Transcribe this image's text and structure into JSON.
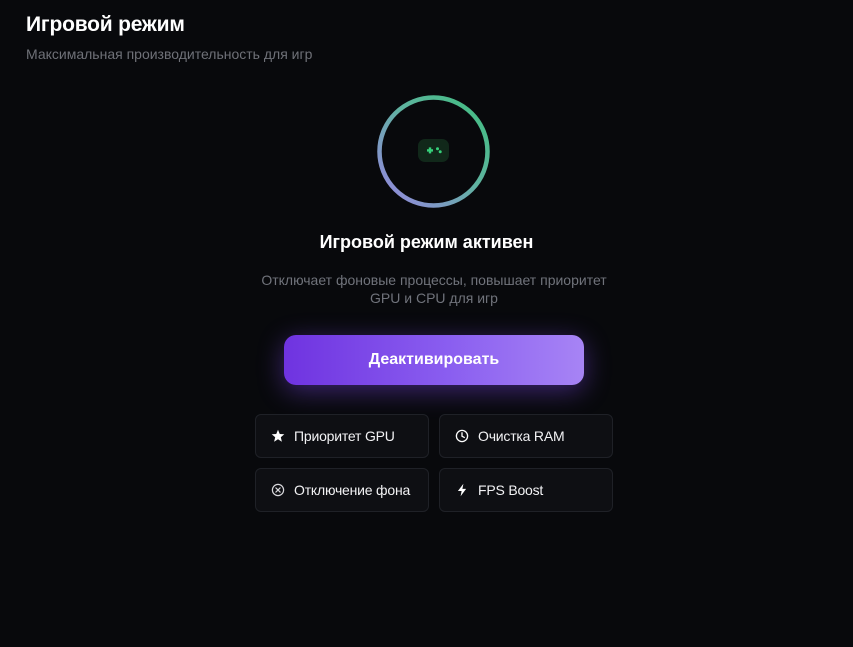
{
  "header": {
    "title": "Игровой режим",
    "subtitle": "Максимальная производительность для игр"
  },
  "status": {
    "icon": "gamepad-icon",
    "title": "Игровой режим активен",
    "description": "Отключает фоновые процессы, повышает приоритет GPU и CPU для игр",
    "ring_colors": [
      "#3fbf7f",
      "#9a84e6"
    ]
  },
  "action": {
    "label": "Деактивировать",
    "gradient": [
      "#6f33e0",
      "#a784f5"
    ]
  },
  "features": [
    {
      "icon": "star-icon",
      "label": "Приоритет GPU"
    },
    {
      "icon": "clock-icon",
      "label": "Очистка RAM"
    },
    {
      "icon": "close-circle-icon",
      "label": "Отключение фона"
    },
    {
      "icon": "lightning-icon",
      "label": "FPS Boost"
    }
  ],
  "colors": {
    "background": "#08090c",
    "accent_green": "#3fbf7f",
    "accent_purple": "#8a5ef0"
  }
}
